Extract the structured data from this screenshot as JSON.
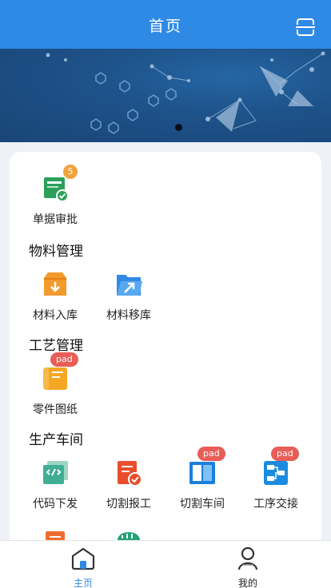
{
  "header": {
    "title": "首页",
    "scan_icon": "scan-icon"
  },
  "banner": {
    "dots": 3,
    "active_dot": 3
  },
  "approval": {
    "label": "单据审批",
    "badge": "5"
  },
  "sections": [
    {
      "title": "物料管理",
      "items": [
        {
          "label": "材料入库"
        },
        {
          "label": "材料移库"
        }
      ]
    },
    {
      "title": "工艺管理",
      "items": [
        {
          "label": "零件图纸",
          "badge": "pad"
        }
      ]
    },
    {
      "title": "生产车间",
      "items": [
        {
          "label": "代码下发"
        },
        {
          "label": "切割报工"
        },
        {
          "label": "切割车间",
          "badge": "pad"
        },
        {
          "label": "工序交接",
          "badge": "pad"
        }
      ]
    }
  ],
  "tabbar": {
    "items": [
      {
        "label": "主页",
        "active": true
      },
      {
        "label": "我的",
        "active": false
      }
    ]
  },
  "colors": {
    "primary": "#2f8ae6",
    "badge_orange": "#f0a33c",
    "badge_red": "#e85d57"
  }
}
